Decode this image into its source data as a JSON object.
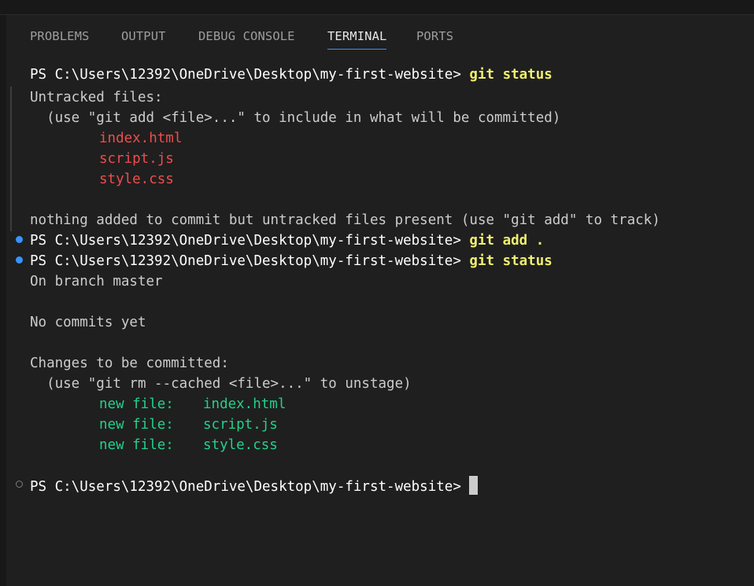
{
  "tabs": [
    {
      "label": "PROBLEMS"
    },
    {
      "label": "OUTPUT"
    },
    {
      "label": "DEBUG CONSOLE"
    },
    {
      "label": "TERMINAL"
    },
    {
      "label": "PORTS"
    }
  ],
  "terminal": {
    "prompt": "PS C:\\Users\\12392\\OneDrive\\Desktop\\my-first-website>",
    "cmd1": "git status",
    "untracked_header": "Untracked files:",
    "untracked_hint": "  (use \"git add <file>...\" to include in what will be committed)",
    "untracked_files": [
      "index.html",
      "script.js",
      "style.css"
    ],
    "nothing_added": "nothing added to commit but untracked files present (use \"git add\" to track)",
    "cmd2": "git add .",
    "cmd3": "git status",
    "on_branch": "On branch master",
    "no_commits": "No commits yet",
    "changes_header": "Changes to be committed:",
    "changes_hint": "  (use \"git rm --cached <file>...\" to unstage)",
    "new_file_label": "new file:",
    "staged_files": [
      "index.html",
      "script.js",
      "style.css"
    ]
  }
}
